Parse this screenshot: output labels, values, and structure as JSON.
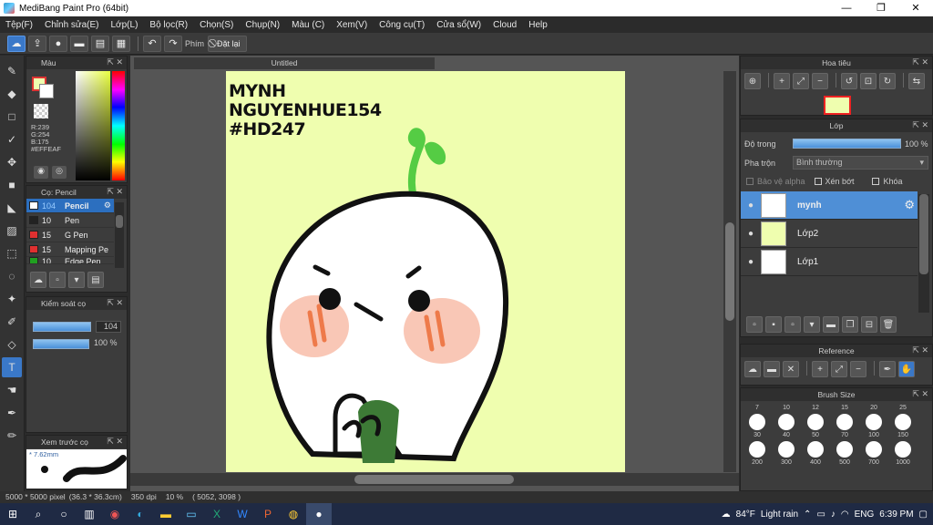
{
  "window": {
    "title": "MediBang Paint Pro (64bit)",
    "minimize": "—",
    "maximize": "❐",
    "close": "✕"
  },
  "menu": [
    "Tệp(F)",
    "Chỉnh sửa(E)",
    "Lớp(L)",
    "Bộ lọc(R)",
    "Chọn(S)",
    "Chụp(N)",
    "Màu (C)",
    "Xem(V)",
    "Công cụ(T)",
    "Cửa sổ(W)",
    "Cloud",
    "Help"
  ],
  "toolbar": {
    "shortcut_label": "Phím",
    "reset_label": "Đặt lại"
  },
  "color_panel": {
    "title": "Màu",
    "r": "R:239",
    "g": "G:254",
    "b": "B:175",
    "hex": "#EFFEAF"
  },
  "brush_panel": {
    "title": "Cọ: Pencil",
    "brushes": [
      {
        "size": "104",
        "name": "Pencil",
        "color": "#ffffff"
      },
      {
        "size": "10",
        "name": "Pen",
        "color": "#222222"
      },
      {
        "size": "15",
        "name": "G Pen",
        "color": "#e03030"
      },
      {
        "size": "15",
        "name": "Mapping Pe",
        "color": "#e03030"
      },
      {
        "size": "10",
        "name": "Edge Pen",
        "color": "#20a020"
      }
    ]
  },
  "brush_control": {
    "title": "Kiểm soát cọ",
    "size": "104",
    "opacity": "100 %"
  },
  "brush_preview": {
    "title": "Xem trước cọ",
    "size": "* 7.62mm"
  },
  "document": {
    "tab": "Untitled",
    "line1": "MYNH",
    "line2": "NGUYENHUE154",
    "line3": "#HD247"
  },
  "navigator": {
    "title": "Hoa tiêu"
  },
  "layer_panel": {
    "title": "Lớp",
    "opacity_label": "Độ trong",
    "opacity_value": "100 %",
    "blend_label": "Pha trộn",
    "blend_value": "Bình thường",
    "protect_alpha": "Bảo vệ alpha",
    "clipping": "Xén bớt",
    "lock": "Khóa",
    "layers": [
      {
        "name": "mynh"
      },
      {
        "name": "Lớp2"
      },
      {
        "name": "Lớp1"
      }
    ]
  },
  "reference": {
    "title": "Reference"
  },
  "brush_size": {
    "title": "Brush Size",
    "row1": [
      "7",
      "10",
      "12",
      "15",
      "20",
      "25"
    ],
    "row2": [
      "30",
      "40",
      "50",
      "70",
      "100",
      "150"
    ],
    "row3": [
      "200",
      "300",
      "400",
      "500",
      "700",
      "1000"
    ]
  },
  "status": {
    "dimensions": "5000 * 5000 pixel",
    "size_cm": "(36.3 * 36.3cm)",
    "dpi": "350 dpi",
    "zoom": "10 %",
    "coords": "( 5052, 3098 )"
  },
  "taskbar": {
    "temperature": "84°F",
    "weather": "Light rain",
    "language": "ENG",
    "time": "6:39 PM"
  }
}
